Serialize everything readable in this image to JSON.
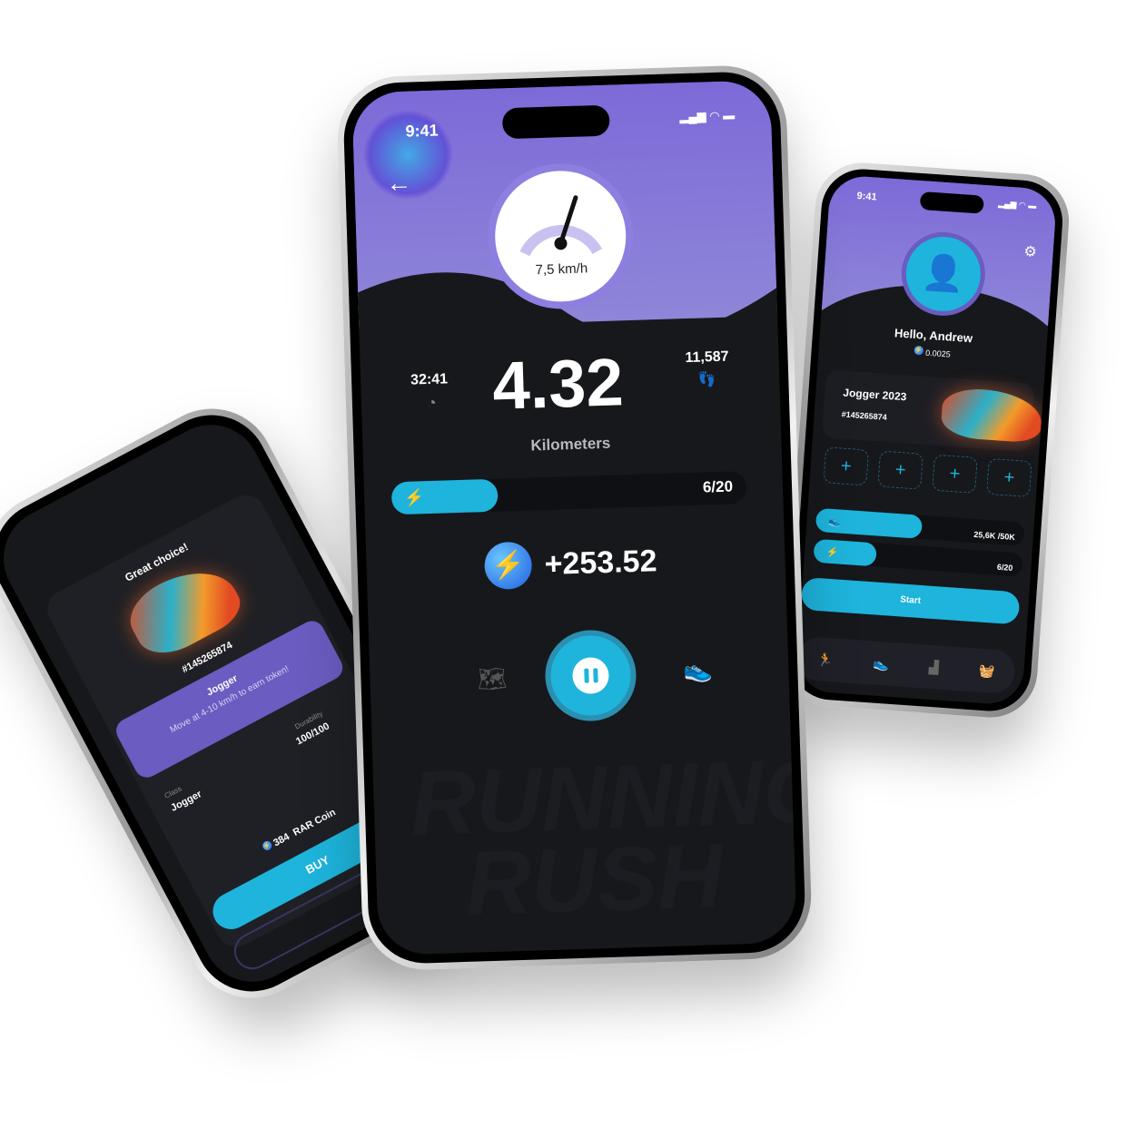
{
  "left_phone": {
    "heading": "Great choice!",
    "sneaker_id": "#145265874",
    "class_name": "Jogger",
    "class_desc": "Move at 4-10 km/h to earn token!",
    "class_label": "Class",
    "class_value": "Jogger",
    "durability_label": "Durability",
    "durability_value": "100/100",
    "price": "384",
    "currency": "RAR Coin",
    "buy_label": "BUY"
  },
  "center_phone": {
    "time": "9:41",
    "speed": "7,5 km/h",
    "duration": "32:41",
    "steps": "11,587",
    "distance": "4.32",
    "distance_unit": "Kilometers",
    "energy": "6/20",
    "energy_fraction": 0.3,
    "earned": "+253.52",
    "watermark": "RUNNING RUSH",
    "accent": "#1eb4dc",
    "purple": "#8a7ad8"
  },
  "right_phone": {
    "time": "9:41",
    "greeting": "Hello, Andrew",
    "balance": "0.0025",
    "sneaker_name": "Jogger 2023",
    "sneaker_id": "#145265874",
    "slots": [
      "+",
      "+",
      "+",
      "+"
    ],
    "distance_progress": "25,6K /50K",
    "distance_fraction": 0.51,
    "energy": "6/20",
    "energy_fraction": 0.3,
    "start_label": "Start",
    "nav": [
      "run-icon",
      "sneaker-icon",
      "leaderboard-icon",
      "shop-icon"
    ]
  }
}
